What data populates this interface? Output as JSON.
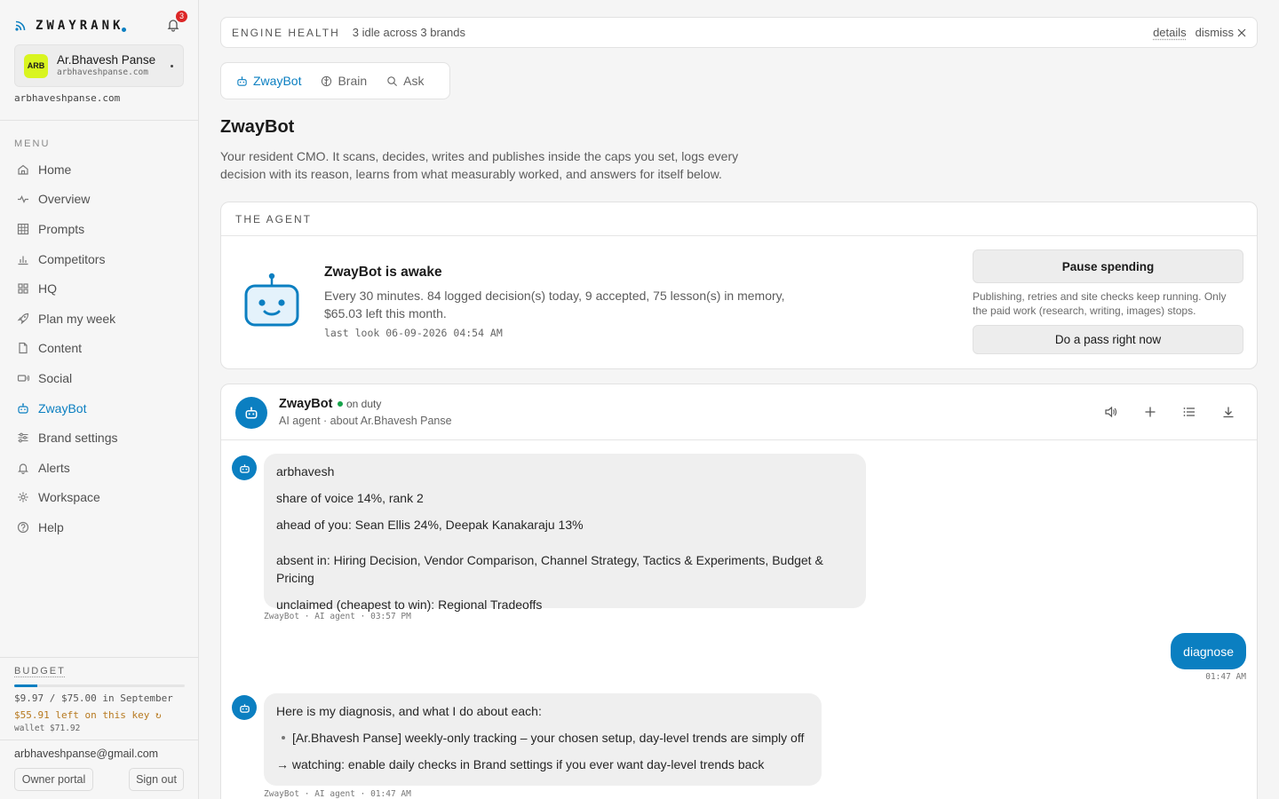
{
  "sidebar": {
    "logo": "ZWAYRANK",
    "notification_count": "3",
    "brand": {
      "avatar": "ARB",
      "name": "Ar.Bhavesh Panse",
      "domain": "arbhaveshpanse.com"
    },
    "domain_line": "arbhaveshpanse.com",
    "menu_label": "MENU",
    "items": [
      {
        "label": "Home",
        "icon": "home-icon"
      },
      {
        "label": "Overview",
        "icon": "pulse-icon"
      },
      {
        "label": "Prompts",
        "icon": "grid-icon"
      },
      {
        "label": "Competitors",
        "icon": "bar-chart-icon"
      },
      {
        "label": "HQ",
        "icon": "squares-icon"
      },
      {
        "label": "Plan my week",
        "icon": "rocket-icon"
      },
      {
        "label": "Content",
        "icon": "document-icon"
      },
      {
        "label": "Social",
        "icon": "megaphone-icon"
      },
      {
        "label": "ZwayBot",
        "icon": "bot-icon",
        "active": true
      },
      {
        "label": "Brand settings",
        "icon": "sliders-icon"
      },
      {
        "label": "Alerts",
        "icon": "bell-icon"
      },
      {
        "label": "Workspace",
        "icon": "gear-icon"
      },
      {
        "label": "Help",
        "icon": "help-icon"
      }
    ],
    "budget": {
      "label": "BUDGET",
      "spent_fraction": 0.133,
      "line1": "$9.97 / $75.00 in September",
      "line2": "$55.91 left on this key ↻",
      "line3": "wallet $71.92"
    },
    "email": "arbhaveshpanse@gmail.com",
    "owner_portal": "Owner portal",
    "sign_out": "Sign out"
  },
  "engine": {
    "title": "ENGINE HEALTH",
    "status": "3 idle across 3 brands",
    "details": "details",
    "dismiss": "dismiss"
  },
  "tabs": [
    {
      "label": "ZwayBot",
      "icon": "bot-icon",
      "active": true
    },
    {
      "label": "Brain",
      "icon": "brain-icon"
    },
    {
      "label": "Ask",
      "icon": "search-icon"
    }
  ],
  "page": {
    "title": "ZwayBot",
    "description": "Your resident CMO. It scans, decides, writes and publishes inside the caps you set, logs every decision with its reason, learns from what measurably worked, and answers for itself below."
  },
  "agent": {
    "section_label": "THE AGENT",
    "status": "ZwayBot is awake",
    "summary": "Every 30 minutes. 84 logged decision(s) today, 9 accepted, 75 lesson(s) in memory, $65.03 left this month.",
    "last_look": "last look 06-09-2026 04:54 AM",
    "pause_button": "Pause spending",
    "pause_note": "Publishing, retries and site checks keep running. Only the paid work (research, writing, images) stops.",
    "pass_button": "Do a pass right now"
  },
  "chat": {
    "name": "ZwayBot",
    "status": "on duty",
    "subtitle": "AI agent · about Ar.Bhavesh Panse",
    "messages": [
      {
        "from": "bot",
        "lines": [
          "arbhavesh",
          "share of voice 14%, rank 2",
          "ahead of you: Sean Ellis 24%, Deepak Kanakaraju 13%",
          "absent in: Hiring Decision, Vendor Comparison, Channel Strategy, Tactics & Experiments, Budget & Pricing",
          "unclaimed (cheapest to win): Regional Tradeoffs"
        ],
        "meta": "ZwayBot · AI agent · 03:57 PM"
      },
      {
        "from": "user",
        "text": "diagnose",
        "meta": "01:47 AM"
      },
      {
        "from": "bot",
        "intro": "Here is my diagnosis, and what I do about each:",
        "bullet": "[Ar.Bhavesh Panse] weekly-only tracking – your chosen setup, day-level trends are simply off",
        "action": "→ watching: enable daily checks in Brand settings if you ever want day-level trends back",
        "meta": "ZwayBot · AI agent · 01:47 AM"
      }
    ]
  },
  "colors": {
    "accent": "#0b7fc1",
    "brand_avatar": "#d9f51f",
    "badge": "#dc2626",
    "duty": "#16a34a",
    "budget_warn": "#b7791f"
  }
}
